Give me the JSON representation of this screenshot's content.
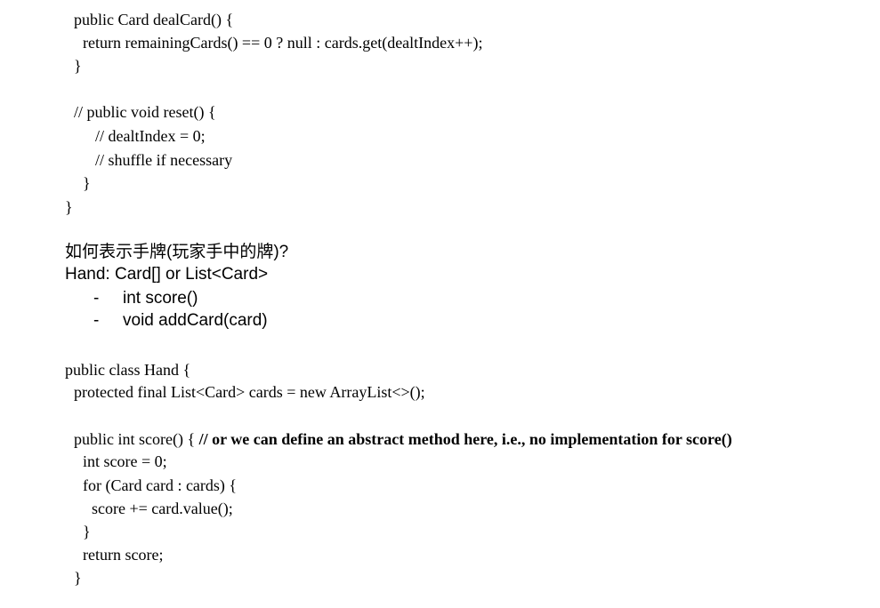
{
  "code_top": {
    "l1": "public Card dealCard() {",
    "l2": "return remainingCards() == 0 ? null : cards.get(dealtIndex++);",
    "l3": "}",
    "l4": "// public void reset() {",
    "l5": "// dealtIndex = 0;",
    "l6": "// shuffle if necessary",
    "l7": "}",
    "l8": "}"
  },
  "notes": {
    "question": "如何表示手牌(玩家手中的牌)?",
    "hand": "Hand: Card[] or List<Card>",
    "bullet_marker": "-",
    "bullets": [
      "int score()",
      "void addCard(card)"
    ]
  },
  "code_bottom": {
    "l1": "public class Hand {",
    "l2": "protected final List<Card> cards = new ArrayList<>();",
    "l3_code": "public int score() { ",
    "l3_comment": "// or we can define an abstract method here, i.e., no implementation for score()",
    "l4": "int score = 0;",
    "l5": "for (Card card : cards) {",
    "l6": "score += card.value();",
    "l7": "}",
    "l8": "return score;",
    "l9": "}"
  }
}
